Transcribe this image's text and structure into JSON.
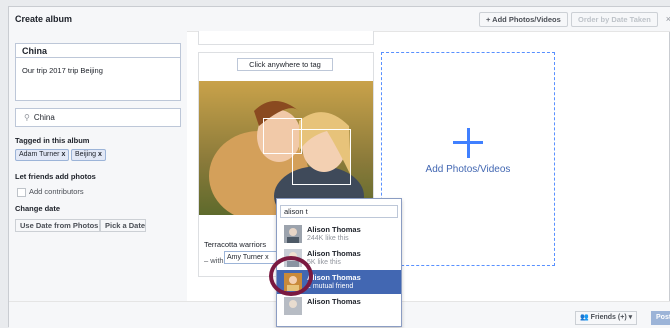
{
  "header": {
    "title": "Create album",
    "add_button": "+ Add Photos/Videos",
    "order_button": "Order by Date Taken",
    "close": "×"
  },
  "album": {
    "name": "China",
    "description": "Our trip 2017 trip Beijing",
    "location": "China"
  },
  "tagged": {
    "label": "Tagged in this album",
    "tags": [
      "Adam Turner",
      "Beijing"
    ],
    "remove_glyph": "x"
  },
  "contributors": {
    "label": "Let friends add photos",
    "checkbox_label": "Add contributors",
    "checked": false
  },
  "change_date": {
    "label": "Change date",
    "use_date_button": "Use Date from Photos",
    "pick_date_button": "Pick a Date"
  },
  "photo_card": {
    "tag_prompt": "Click anywhere to tag",
    "caption": "Terracotta warriors",
    "with_label": "– with",
    "with_tag": "Amy Turner x"
  },
  "add_card": {
    "label": "Add Photos/Videos"
  },
  "tag_dropdown": {
    "query": "alison t",
    "results": [
      {
        "name": "Alison Thomas",
        "sub": "244K like this",
        "selected": false
      },
      {
        "name": "Alison Thomas",
        "sub": "5K like this",
        "selected": false
      },
      {
        "name": "Alison Thomas",
        "sub": "1 mutual friend",
        "selected": true
      },
      {
        "name": "Alison Thomas",
        "sub": "",
        "selected": false
      }
    ]
  },
  "footer": {
    "audience": "Friends (+) ▾",
    "post": "Post"
  },
  "colors": {
    "accent": "#4267b2",
    "selected_bg": "#4267b2",
    "highlight_ring": "#7a1940",
    "dash_border": "#5890ff"
  }
}
